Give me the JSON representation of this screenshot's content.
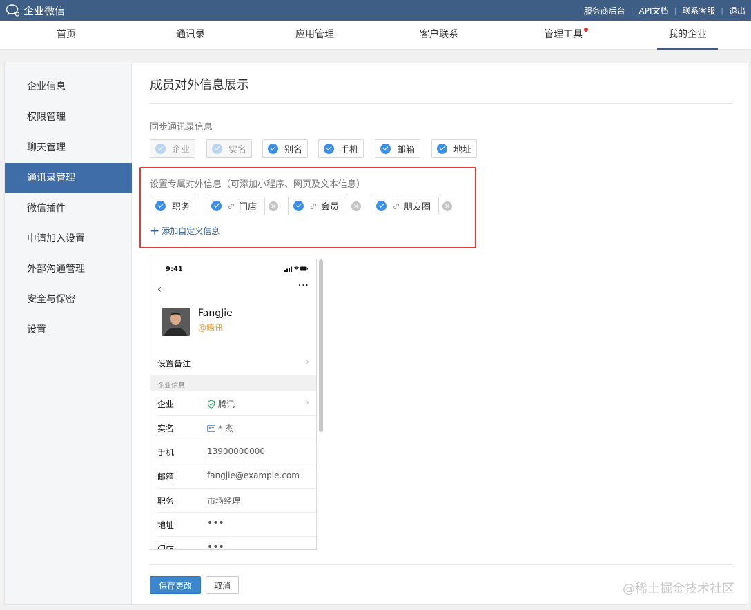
{
  "app": {
    "title": "企业微信"
  },
  "toplinks": [
    "服务商后台",
    "API文档",
    "联系客服",
    "退出"
  ],
  "nav": [
    "首页",
    "通讯录",
    "应用管理",
    "客户联系",
    "管理工具",
    "我的企业"
  ],
  "nav_active": "我的企业",
  "sidebar": [
    "企业信息",
    "权限管理",
    "聊天管理",
    "通讯录管理",
    "微信插件",
    "申请加入设置",
    "外部沟通管理",
    "安全与保密",
    "设置"
  ],
  "sidebar_active": "通讯录管理",
  "page_title": "成员对外信息展示",
  "sync": {
    "label": "同步通讯录信息",
    "tags": [
      {
        "label": "企业",
        "disabled": true
      },
      {
        "label": "实名",
        "disabled": true
      },
      {
        "label": "别名",
        "disabled": false
      },
      {
        "label": "手机",
        "disabled": false
      },
      {
        "label": "邮箱",
        "disabled": false
      },
      {
        "label": "地址",
        "disabled": false
      }
    ]
  },
  "custom": {
    "label": "设置专属对外信息（可添加小程序、网页及文本信息）",
    "tags": [
      {
        "label": "职务",
        "link": false,
        "removable": false
      },
      {
        "label": "门店",
        "link": true,
        "removable": true
      },
      {
        "label": "会员",
        "link": true,
        "removable": true
      },
      {
        "label": "朋友圈",
        "link": true,
        "removable": true
      }
    ],
    "add_label": "添加自定义信息"
  },
  "phone": {
    "time": "9:41",
    "name": "FangJie",
    "corp": "@腾讯",
    "remark": "设置备注",
    "section": "企业信息",
    "rows": [
      {
        "label": "企业",
        "value": "腾讯",
        "icon": "verified-shield-icon"
      },
      {
        "label": "实名",
        "value": "* 杰",
        "icon": "id-card-icon"
      },
      {
        "label": "手机",
        "value": "13900000000"
      },
      {
        "label": "邮箱",
        "value": "fangjie@example.com"
      },
      {
        "label": "职务",
        "value": "市场经理"
      },
      {
        "label": "地址",
        "value": "•••"
      },
      {
        "label": "门店",
        "value": "•••"
      }
    ]
  },
  "buttons": {
    "save": "保存更改",
    "cancel": "取消"
  },
  "watermark": "@稀土掘金技术社区",
  "colors": {
    "topbar": "#3e5e86",
    "accent": "#3b87cf",
    "highlight": "#e03f36",
    "check": "#3b8fe6"
  }
}
